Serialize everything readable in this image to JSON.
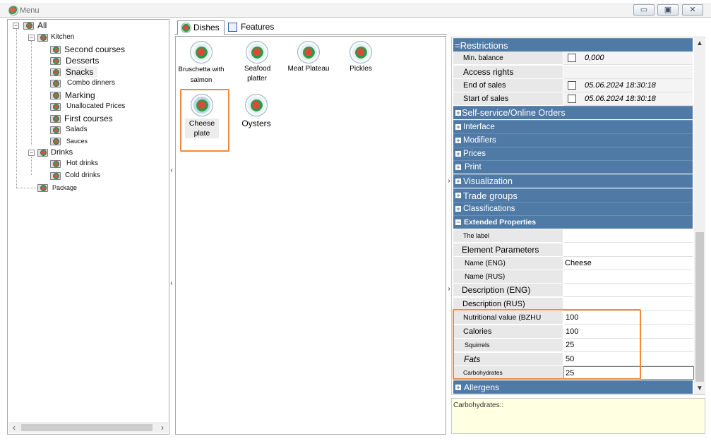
{
  "window": {
    "title": "Menu",
    "buttons": {
      "minimize": "▭",
      "restore": "▣",
      "close": "✕"
    }
  },
  "tree": {
    "root": "All",
    "kitchen": {
      "label": "Kitchen",
      "items": [
        "Second courses",
        "Desserts",
        "Snacks",
        "Combo dinners",
        "Marking",
        "Unallocated Prices",
        "First courses",
        "Salads",
        "Sauces"
      ]
    },
    "drinks": {
      "label": "Drinks",
      "items": [
        "Hot drinks",
        "Cold drinks"
      ]
    },
    "package": "Package"
  },
  "tabs": [
    "Dishes",
    "Features"
  ],
  "dishes": [
    {
      "name": "Bruschetta with salmon"
    },
    {
      "name": "Seafood platter"
    },
    {
      "name": "Meat Plateau"
    },
    {
      "name": "Pickles"
    },
    {
      "name": "Cheese plate"
    },
    {
      "name": "Oysters"
    }
  ],
  "properties": {
    "restrictions": {
      "title": "Restrictions",
      "rows": [
        {
          "name": "Min. balance",
          "value": "0,000"
        },
        {
          "name": "Access rights",
          "value": ""
        },
        {
          "name": "End of sales",
          "value": "05.06.2024 18:30:18"
        },
        {
          "name": "Start of sales",
          "value": "05.06.2024 18:30:18"
        }
      ]
    },
    "categories": [
      "Self-service/Online Orders",
      "Interface",
      "Modifiers",
      "Prices",
      "Print",
      "Visualization",
      "Trade groups",
      "Classifications"
    ],
    "extended": {
      "title": "Extended Properties",
      "rows": [
        {
          "name": "The label",
          "value": ""
        },
        {
          "name": "Element Parameters",
          "value": ""
        },
        {
          "name": "Name (ENG)",
          "value": "Cheese"
        },
        {
          "name": "Name (RUS)",
          "value": ""
        },
        {
          "name": "Description (ENG)",
          "value": ""
        },
        {
          "name": "Description (RUS)",
          "value": ""
        },
        {
          "name": "Nutritional value (BZHU",
          "value": "100"
        },
        {
          "name": "Calories",
          "value": "100"
        },
        {
          "name": "Squirrels",
          "value": "25"
        },
        {
          "name": "Fats",
          "value": "50"
        },
        {
          "name": "Carbohydrates",
          "value": "25"
        }
      ]
    },
    "allergens": "Allergens"
  },
  "description": "Carbohydrates::",
  "colors": {
    "category": "#4f7aa6",
    "highlight": "#f28a3a",
    "description_bg": "#ffffe1"
  }
}
